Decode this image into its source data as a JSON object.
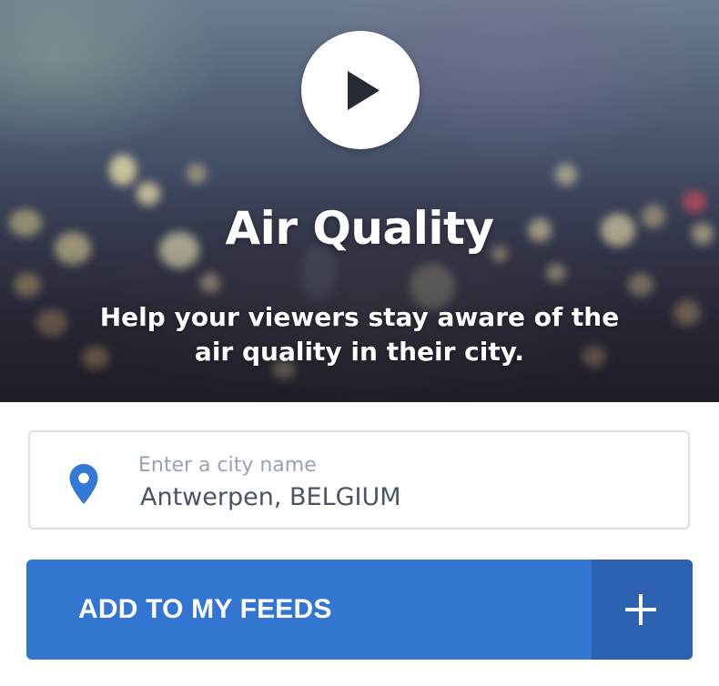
{
  "hero": {
    "title": "Air Quality",
    "subtitle": "Help your viewers stay aware of the air quality in their city.",
    "play_icon": "play-icon"
  },
  "city_field": {
    "label": "Enter a city name",
    "value": "Antwerpen, BELGIUM",
    "icon": "map-pin-icon",
    "icon_color": "#3478d6"
  },
  "add_button": {
    "label": "ADD TO MY FEEDS",
    "icon": "plus-icon",
    "color": "#3376d2",
    "icon_area_color": "#2b61b0"
  }
}
